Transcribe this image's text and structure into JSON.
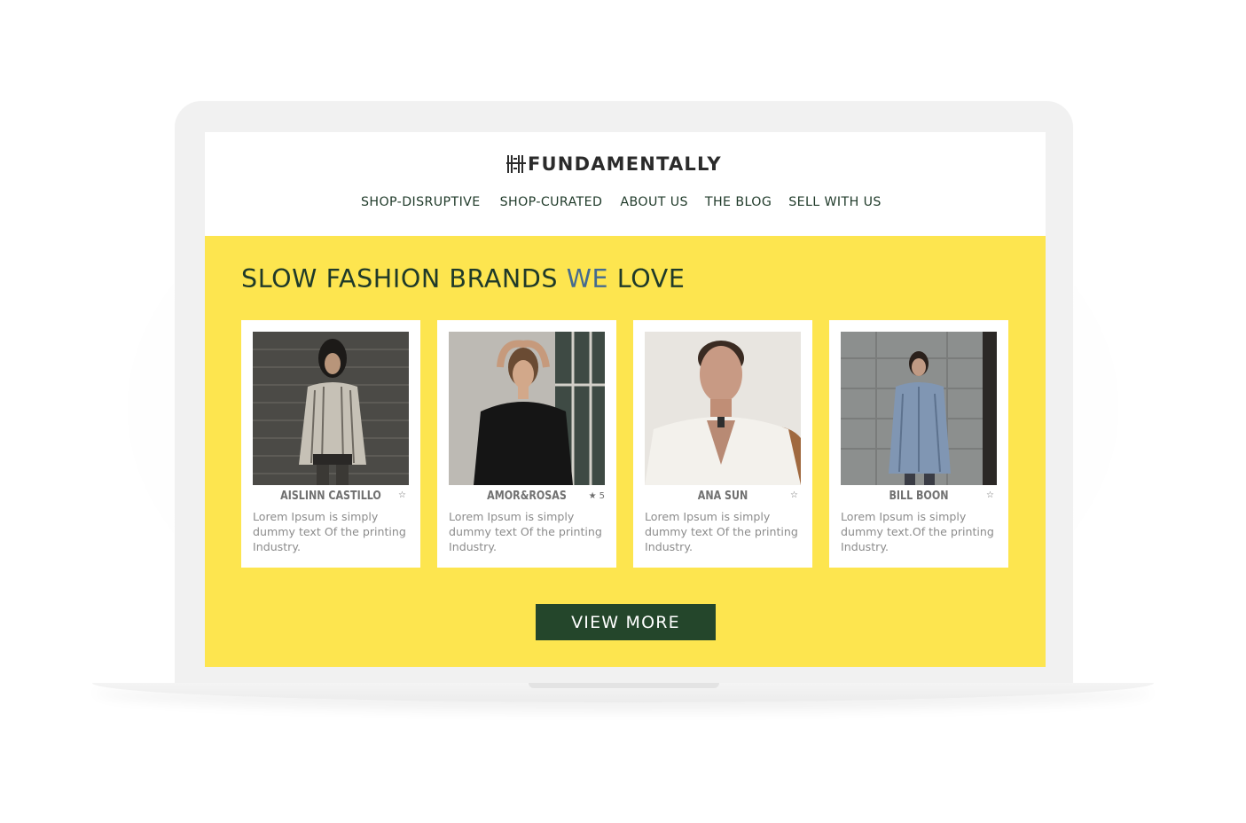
{
  "header": {
    "logo_text": "FUNDAMENTALLY",
    "nav": [
      "SHOP-DISRUPTIVE",
      "SHOP-CURATED",
      "ABOUT US",
      "THE BLOG",
      "SELL WITH US"
    ]
  },
  "section": {
    "title_part1": "SLOW FASHION BRANDS ",
    "title_accent": "WE",
    "title_part2": " LOVE",
    "cards": [
      {
        "name": "AISLINN CASTILLO",
        "rating": "",
        "starred": false,
        "description": "Lorem Ipsum is simply dummy text Of the printing Industry."
      },
      {
        "name": "AMOR&ROSAS",
        "rating": "5",
        "starred": true,
        "description": "Lorem Ipsum is simply dummy text Of the printing Industry."
      },
      {
        "name": "ANA SUN",
        "rating": "",
        "starred": false,
        "description": "Lorem Ipsum is simply dummy text  Of the printing Industry."
      },
      {
        "name": "BILL BOON",
        "rating": "",
        "starred": false,
        "description": "Lorem Ipsum is simply dummy text.Of the printing Industry."
      }
    ],
    "view_more_label": "VIEW MORE"
  },
  "colors": {
    "section_bg": "#fde54f",
    "primary_green": "#24462b",
    "nav_text": "#1f3a29",
    "accent_blue": "#456b8f",
    "card_text": "#8c8c8c"
  },
  "icons": {
    "logo": "fundamentally-logo-icon",
    "filled_star": "star-filled-icon",
    "empty_star": "star-outline-icon"
  }
}
